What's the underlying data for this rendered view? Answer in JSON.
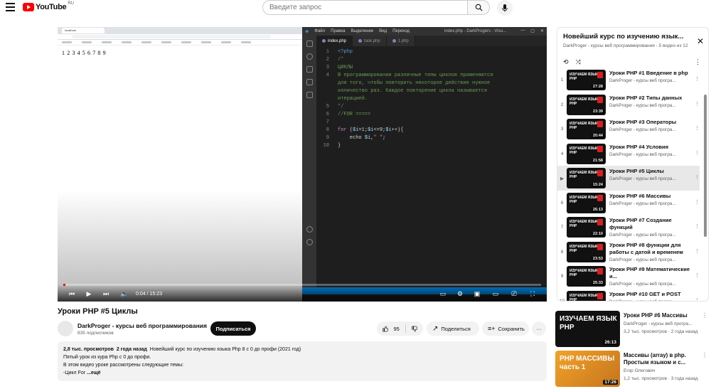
{
  "masthead": {
    "logo_text": "YouTube",
    "country": "RU",
    "search_placeholder": "Введите запрос"
  },
  "player": {
    "browser_tab": "localhost",
    "page_output": "1 2 3 4 5 6 7 8 9",
    "vscode_menu": [
      "Файл",
      "Правка",
      "Выделение",
      "Вид",
      "Переход"
    ],
    "vscode_title": "index.php - DarkProgers - Visu...",
    "vscode_tabs": [
      "index.php",
      "task.php",
      "1.php"
    ],
    "code_lines": [
      {
        "n": "1",
        "html": "<span class=\"c-tag\">&lt;?php</span>"
      },
      {
        "n": "2",
        "html": "<span class=\"c-comment\">/*</span>"
      },
      {
        "n": "3",
        "html": "<span class=\"c-comment\">ЦИКЛЫ</span>"
      },
      {
        "n": "4",
        "html": "<span class=\"c-comment\">В программировании различные типы циклов применяются</span>"
      },
      {
        "n": "",
        "html": "<span class=\"c-comment\">для того, чтобы повторить некоторое действие нужное</span>"
      },
      {
        "n": "",
        "html": "<span class=\"c-comment\">количество раз. Каждое повторение цикла называется</span>"
      },
      {
        "n": "",
        "html": "<span class=\"c-comment\">итерацией.</span>"
      },
      {
        "n": "5",
        "html": "<span class=\"c-comment\">*/</span>"
      },
      {
        "n": "6",
        "html": "<span class=\"c-comment\">//FOR =====</span>"
      },
      {
        "n": "7",
        "html": ""
      },
      {
        "n": "8",
        "html": "<span class=\"c-kw\">for</span> (<span class=\"c-var\">$i</span>=1;<span class=\"c-var\">$i</span>&lt;=9;<span class=\"c-var\">$i</span>++){"
      },
      {
        "n": "9",
        "html": "    echo <span class=\"c-var\">$i</span>,<span class=\"c-str\">\" \"</span>;"
      },
      {
        "n": "10",
        "html": "}"
      }
    ],
    "time": "0:04 / 15:23",
    "progress": 0.0043
  },
  "video": {
    "title": "Уроки PHP #5 Циклы",
    "channel": "DarkProger - курсы веб программирования",
    "subscribers": "835 подписчиков",
    "subscribe_label": "Подписаться",
    "likes": "95",
    "share_label": "Поделиться",
    "save_label": "Сохранить"
  },
  "description": {
    "views": "2,8 тыс. просмотров",
    "date": "2 года назад",
    "summary": "Новейший курс по изучению языка Php 8 с 0 до профи (2021 год)",
    "line2": "Пятый урок из кура Php с 0 до профи.",
    "line3": "В этом видео уроке рассмотрены следующие темы:",
    "line4": "-Цикл For",
    "more": "...ещё"
  },
  "playlist": {
    "title": "Новейший курс по изучению язык...",
    "subtitle": "DarkProger - курсы веб программирования - 5 видео из 12",
    "items": [
      {
        "idx": "1",
        "title": "Уроки PHP #1 Введение в php",
        "channel": "DarkProger - курсы веб програ...",
        "duration": "27:28"
      },
      {
        "idx": "2",
        "title": "Уроки PHP #2 Типы данных",
        "channel": "DarkProger - курсы веб програ...",
        "duration": "23:39"
      },
      {
        "idx": "3",
        "title": "Уроки PHP #3 Операторы",
        "channel": "DarkProger - курсы веб програ...",
        "duration": "20:44"
      },
      {
        "idx": "4",
        "title": "Уроки PHP #4 Условия",
        "channel": "DarkProger - курсы веб програ...",
        "duration": "21:58"
      },
      {
        "idx": "▶",
        "title": "Уроки PHP #5 Циклы",
        "channel": "DarkProger - курсы веб програ...",
        "duration": "15:24"
      },
      {
        "idx": "6",
        "title": "Уроки PHP #6 Массивы",
        "channel": "DarkProger - курсы веб програ...",
        "duration": "26:13"
      },
      {
        "idx": "7",
        "title": "Уроки PHP #7 Создание функций",
        "channel": "DarkProger - курсы веб програ...",
        "duration": "22:10"
      },
      {
        "idx": "8",
        "title": "Уроки PHP #8 функции для работы с датой и временем",
        "channel": "DarkProger - курсы веб програ...",
        "duration": "23:53"
      },
      {
        "idx": "9",
        "title": "Уроки PHP #9 Математические и...",
        "channel": "DarkProger - курсы веб програ...",
        "duration": "25:33"
      },
      {
        "idx": "10",
        "title": "Уроки PHP #10 GET и POST",
        "channel": "DarkProger - курсы веб програ...",
        "duration": ""
      }
    ],
    "thumb_text": "ИЗУЧАЕМ ЯЗЫК PHP"
  },
  "recommended": [
    {
      "title": "Уроки PHP #6 Массивы",
      "channel": "DarkProger - курсы веб програ...",
      "meta": "3,2 тыс. просмотров · 2 года назад",
      "duration": "26:13",
      "thumb_text": "ИЗУЧАЕМ ЯЗЫК PHP"
    },
    {
      "title": "Массивы (array) в php. Простым языком и с...",
      "channel": "Егор Олегович",
      "meta": "1,2 тыс. просмотров · 3 года назад",
      "duration": "17:26",
      "thumb_text": "PHP МАССИВЫ часть 1"
    }
  ],
  "colors": {
    "accent": "#ff0000",
    "vscode_bg": "#1e1e1e",
    "vscode_status": "#007acc"
  }
}
